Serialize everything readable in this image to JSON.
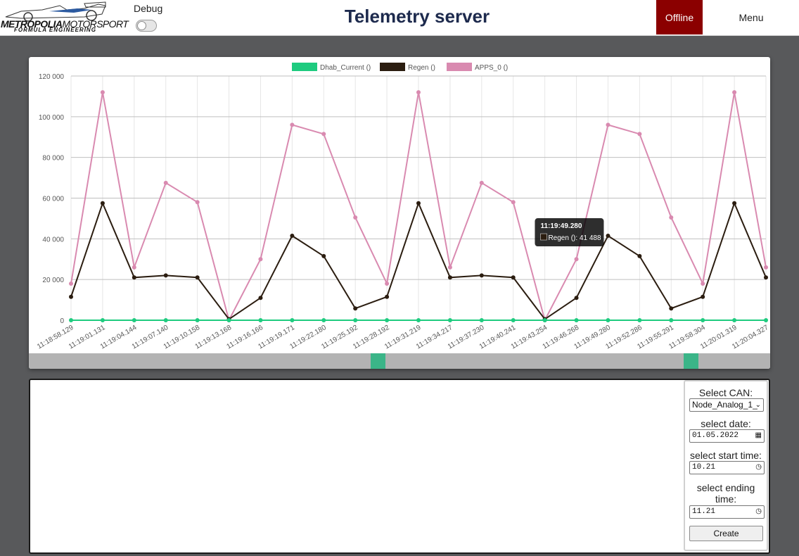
{
  "header": {
    "logo_text_bold": "METROPOLIA",
    "logo_text_thin": "MOTORSPORT",
    "logo_subtext": "FORMULA ENGINEERING",
    "debug_label": "Debug",
    "debug_on": false,
    "title": "Telemetry server",
    "status_label": "Offline",
    "status_color": "#8b0000",
    "menu_label": "Menu"
  },
  "chart_data": {
    "type": "line",
    "title": "",
    "xlabel": "",
    "ylabel": "",
    "ylim": [
      0,
      120000
    ],
    "yticks": [
      "0",
      "20 000",
      "40 000",
      "60 000",
      "80 000",
      "100 000",
      "120 000"
    ],
    "grid": true,
    "legend_position": "top",
    "x": [
      "11:18:58.129",
      "11:19:01.131",
      "11:19:04.144",
      "11:19:07.140",
      "11:19:10.158",
      "11:19:13.168",
      "11:19:16.166",
      "11:19:19.171",
      "11:19:22.180",
      "11:19:25.192",
      "11:19:28.192",
      "11:19:31.219",
      "11:19:34.217",
      "11:19:37.230",
      "11:19:40.241",
      "11:19:43.254",
      "11:19:46.268",
      "11:19:49.280",
      "11:19:52.286",
      "11:19:55.291",
      "11:19:58.304",
      "11:20:01.319",
      "11:20:04.327"
    ],
    "series": [
      {
        "name": "Dhab_Current ()",
        "color": "#1ecb7f",
        "values": [
          0,
          0,
          0,
          0,
          0,
          0,
          0,
          0,
          0,
          0,
          0,
          0,
          0,
          0,
          0,
          0,
          0,
          0,
          0,
          0,
          0,
          0,
          0
        ]
      },
      {
        "name": "Regen ()",
        "color": "#2b1d10",
        "values": [
          11500,
          57500,
          21000,
          22000,
          21000,
          500,
          11000,
          41500,
          31500,
          5800,
          11500,
          57500,
          21000,
          22000,
          21000,
          500,
          11000,
          41488,
          31500,
          5800,
          11500,
          57500,
          21000
        ]
      },
      {
        "name": "APPS_0 ()",
        "color": "#d98ab0",
        "values": [
          18000,
          112000,
          26000,
          67500,
          58000,
          0,
          30000,
          96000,
          91500,
          50500,
          18000,
          112000,
          26000,
          67500,
          58000,
          0,
          30000,
          96000,
          91500,
          50500,
          18000,
          112000,
          26000
        ]
      }
    ],
    "tooltip": {
      "title": "11:19:49.280",
      "label": "Regen (): 41 488",
      "point_index": 17,
      "series_index": 1
    }
  },
  "scrollbar": {
    "thumb_color": "#3bb588"
  },
  "form": {
    "can_label": "Select CAN:",
    "can_value": "Node_Analog_1_",
    "date_label": "select date:",
    "date_value": "01.05.2022",
    "start_label": "select start time:",
    "start_value": "10.21",
    "end_label": "select ending time:",
    "end_value": "11.21",
    "create_label": "Create"
  }
}
